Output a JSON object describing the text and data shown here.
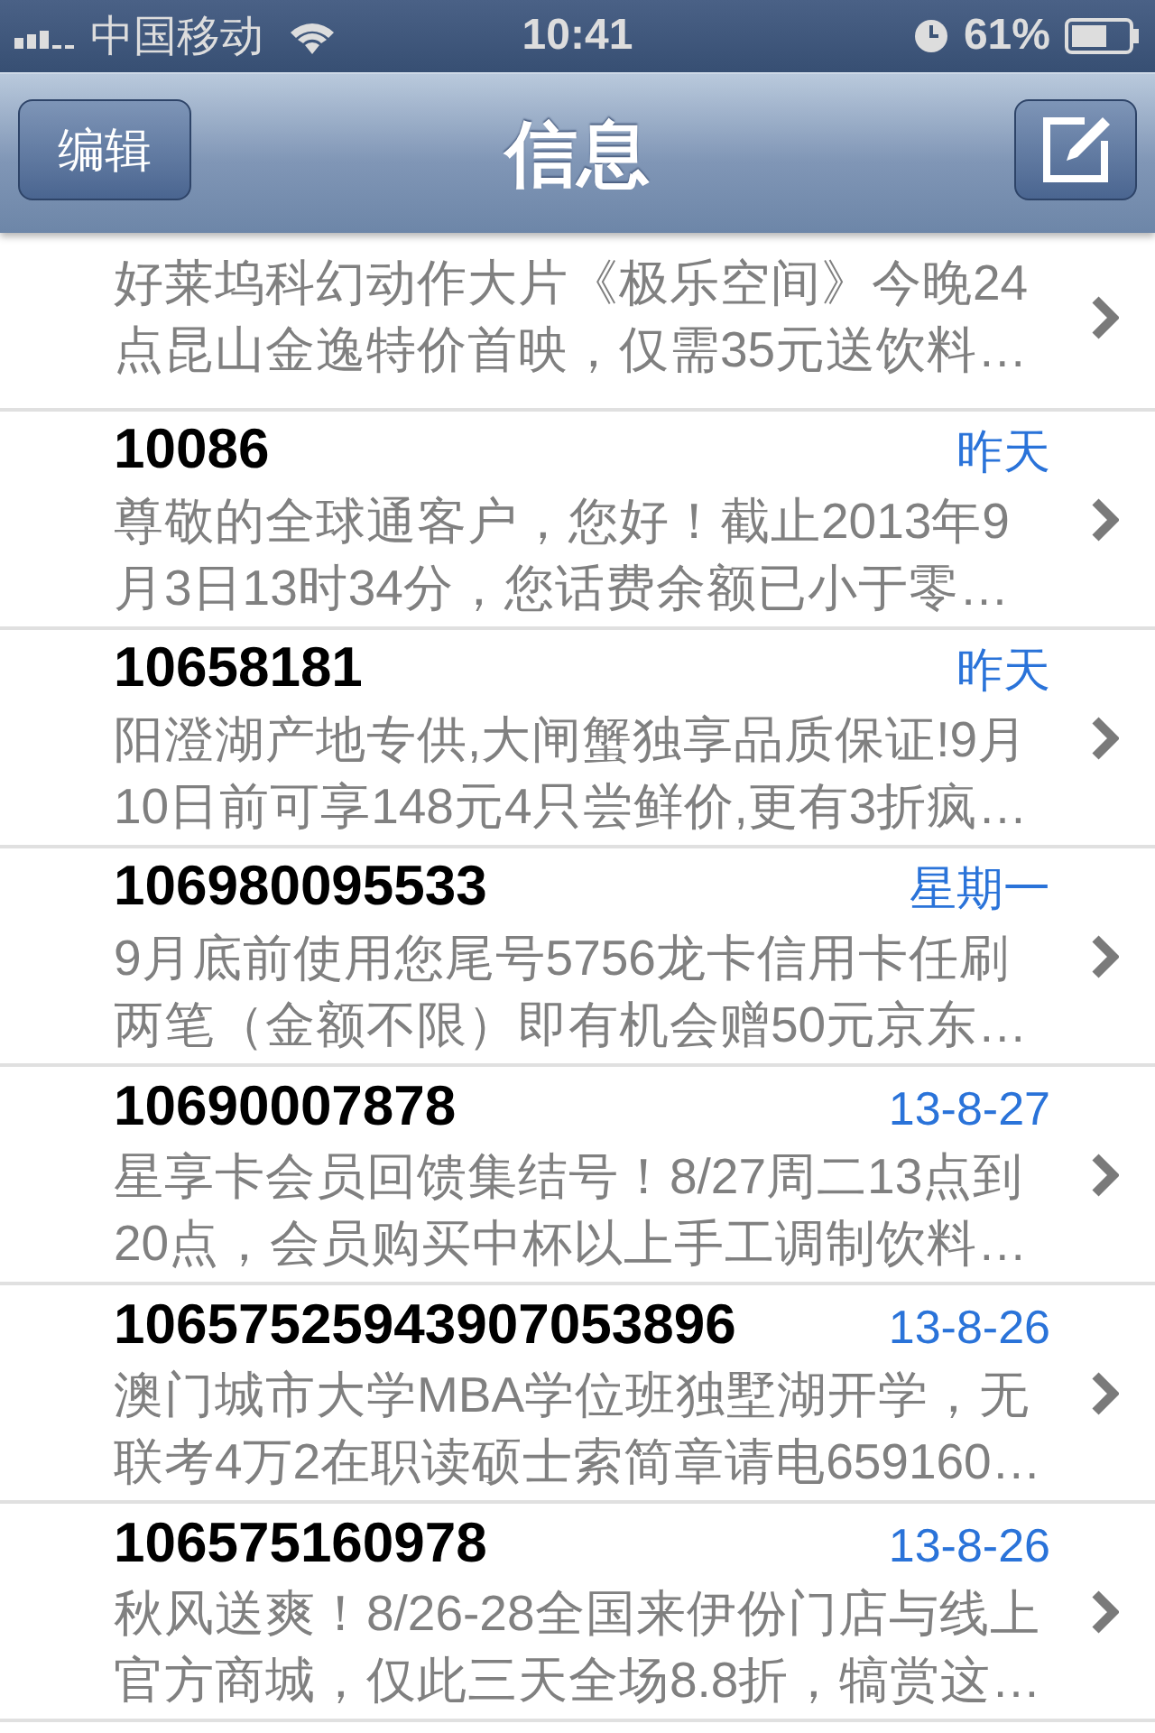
{
  "status_bar": {
    "carrier": "中国移动",
    "time": "10:41",
    "battery": "61%"
  },
  "nav_bar": {
    "edit_button": "编辑",
    "title": "信息"
  },
  "messages": [
    {
      "preview_lines": [
        "好莱坞科幻动作大片《极乐空间》今晚24",
        "点昆山金逸特价首映，仅需35元送饮料…"
      ]
    },
    {
      "sender": "10086",
      "date": "昨天",
      "preview_lines": [
        "尊敬的全球通客户，您好！截止2013年9",
        "月3日13时34分，您话费余额已小于零…"
      ]
    },
    {
      "sender": "10658181",
      "date": "昨天",
      "preview_lines": [
        "阳澄湖产地专供,大闸蟹独享品质保证!9月",
        "10日前可享148元4只尝鲜价,更有3折疯…"
      ]
    },
    {
      "sender": "106980095533",
      "date": "星期一",
      "preview_lines": [
        "9月底前使用您尾号5756龙卡信用卡任刷",
        "两笔（金额不限）即有机会赠50元京东…"
      ]
    },
    {
      "sender": "10690007878",
      "date": "13-8-27",
      "preview_lines": [
        "星享卡会员回馈集结号！8/27周二13点到",
        "20点，会员购买中杯以上手工调制饮料…"
      ]
    },
    {
      "sender": "10657525943907053896",
      "date": "13-8-26",
      "preview_lines": [
        "澳门城市大学MBA学位班独墅湖开学，无",
        "联考4万2在职读硕士索简章请电659160…"
      ]
    },
    {
      "sender": "106575160978",
      "date": "13-8-26",
      "preview_lines": [
        "秋风送爽！8/26-28全国来伊份门店与线上",
        "官方商城，仅此三天全场8.8折，犒赏这…"
      ]
    }
  ]
}
